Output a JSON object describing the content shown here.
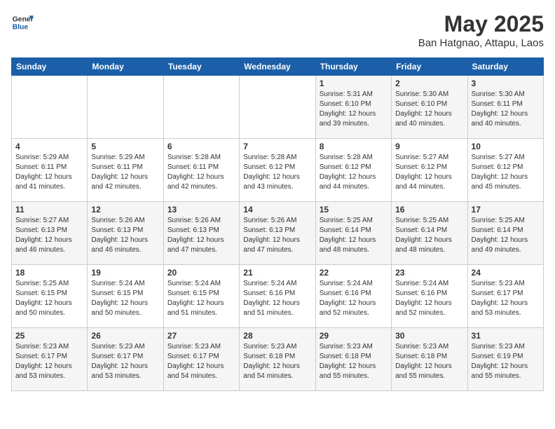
{
  "logo": {
    "line1": "General",
    "line2": "Blue"
  },
  "title": "May 2025",
  "subtitle": "Ban Hatgnao, Attapu, Laos",
  "days_header": [
    "Sunday",
    "Monday",
    "Tuesday",
    "Wednesday",
    "Thursday",
    "Friday",
    "Saturday"
  ],
  "weeks": [
    [
      {
        "day": "",
        "info": ""
      },
      {
        "day": "",
        "info": ""
      },
      {
        "day": "",
        "info": ""
      },
      {
        "day": "",
        "info": ""
      },
      {
        "day": "1",
        "info": "Sunrise: 5:31 AM\nSunset: 6:10 PM\nDaylight: 12 hours\nand 39 minutes."
      },
      {
        "day": "2",
        "info": "Sunrise: 5:30 AM\nSunset: 6:10 PM\nDaylight: 12 hours\nand 40 minutes."
      },
      {
        "day": "3",
        "info": "Sunrise: 5:30 AM\nSunset: 6:11 PM\nDaylight: 12 hours\nand 40 minutes."
      }
    ],
    [
      {
        "day": "4",
        "info": "Sunrise: 5:29 AM\nSunset: 6:11 PM\nDaylight: 12 hours\nand 41 minutes."
      },
      {
        "day": "5",
        "info": "Sunrise: 5:29 AM\nSunset: 6:11 PM\nDaylight: 12 hours\nand 42 minutes."
      },
      {
        "day": "6",
        "info": "Sunrise: 5:28 AM\nSunset: 6:11 PM\nDaylight: 12 hours\nand 42 minutes."
      },
      {
        "day": "7",
        "info": "Sunrise: 5:28 AM\nSunset: 6:12 PM\nDaylight: 12 hours\nand 43 minutes."
      },
      {
        "day": "8",
        "info": "Sunrise: 5:28 AM\nSunset: 6:12 PM\nDaylight: 12 hours\nand 44 minutes."
      },
      {
        "day": "9",
        "info": "Sunrise: 5:27 AM\nSunset: 6:12 PM\nDaylight: 12 hours\nand 44 minutes."
      },
      {
        "day": "10",
        "info": "Sunrise: 5:27 AM\nSunset: 6:12 PM\nDaylight: 12 hours\nand 45 minutes."
      }
    ],
    [
      {
        "day": "11",
        "info": "Sunrise: 5:27 AM\nSunset: 6:13 PM\nDaylight: 12 hours\nand 46 minutes."
      },
      {
        "day": "12",
        "info": "Sunrise: 5:26 AM\nSunset: 6:13 PM\nDaylight: 12 hours\nand 46 minutes."
      },
      {
        "day": "13",
        "info": "Sunrise: 5:26 AM\nSunset: 6:13 PM\nDaylight: 12 hours\nand 47 minutes."
      },
      {
        "day": "14",
        "info": "Sunrise: 5:26 AM\nSunset: 6:13 PM\nDaylight: 12 hours\nand 47 minutes."
      },
      {
        "day": "15",
        "info": "Sunrise: 5:25 AM\nSunset: 6:14 PM\nDaylight: 12 hours\nand 48 minutes."
      },
      {
        "day": "16",
        "info": "Sunrise: 5:25 AM\nSunset: 6:14 PM\nDaylight: 12 hours\nand 48 minutes."
      },
      {
        "day": "17",
        "info": "Sunrise: 5:25 AM\nSunset: 6:14 PM\nDaylight: 12 hours\nand 49 minutes."
      }
    ],
    [
      {
        "day": "18",
        "info": "Sunrise: 5:25 AM\nSunset: 6:15 PM\nDaylight: 12 hours\nand 50 minutes."
      },
      {
        "day": "19",
        "info": "Sunrise: 5:24 AM\nSunset: 6:15 PM\nDaylight: 12 hours\nand 50 minutes."
      },
      {
        "day": "20",
        "info": "Sunrise: 5:24 AM\nSunset: 6:15 PM\nDaylight: 12 hours\nand 51 minutes."
      },
      {
        "day": "21",
        "info": "Sunrise: 5:24 AM\nSunset: 6:16 PM\nDaylight: 12 hours\nand 51 minutes."
      },
      {
        "day": "22",
        "info": "Sunrise: 5:24 AM\nSunset: 6:16 PM\nDaylight: 12 hours\nand 52 minutes."
      },
      {
        "day": "23",
        "info": "Sunrise: 5:24 AM\nSunset: 6:16 PM\nDaylight: 12 hours\nand 52 minutes."
      },
      {
        "day": "24",
        "info": "Sunrise: 5:23 AM\nSunset: 6:17 PM\nDaylight: 12 hours\nand 53 minutes."
      }
    ],
    [
      {
        "day": "25",
        "info": "Sunrise: 5:23 AM\nSunset: 6:17 PM\nDaylight: 12 hours\nand 53 minutes."
      },
      {
        "day": "26",
        "info": "Sunrise: 5:23 AM\nSunset: 6:17 PM\nDaylight: 12 hours\nand 53 minutes."
      },
      {
        "day": "27",
        "info": "Sunrise: 5:23 AM\nSunset: 6:17 PM\nDaylight: 12 hours\nand 54 minutes."
      },
      {
        "day": "28",
        "info": "Sunrise: 5:23 AM\nSunset: 6:18 PM\nDaylight: 12 hours\nand 54 minutes."
      },
      {
        "day": "29",
        "info": "Sunrise: 5:23 AM\nSunset: 6:18 PM\nDaylight: 12 hours\nand 55 minutes."
      },
      {
        "day": "30",
        "info": "Sunrise: 5:23 AM\nSunset: 6:18 PM\nDaylight: 12 hours\nand 55 minutes."
      },
      {
        "day": "31",
        "info": "Sunrise: 5:23 AM\nSunset: 6:19 PM\nDaylight: 12 hours\nand 55 minutes."
      }
    ]
  ]
}
